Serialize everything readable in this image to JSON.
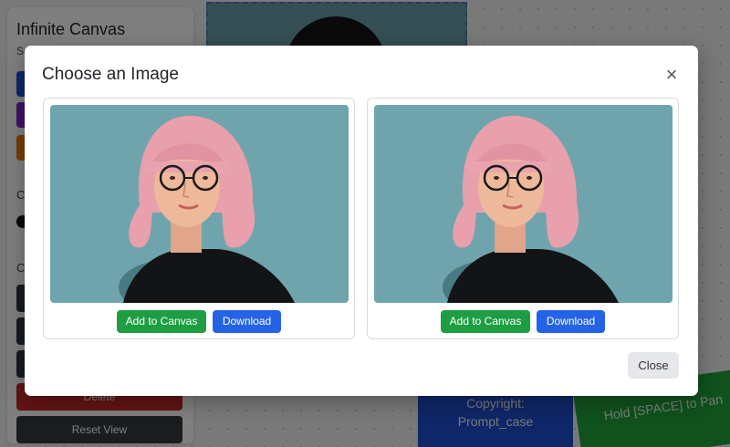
{
  "background": {
    "sidebar": {
      "title": "Infinite Canvas",
      "subtitle": "Se",
      "delete_label": "Delete",
      "reset_label": "Reset View",
      "swatch_colors": [
        "#1d4ed8",
        "#7e22ce",
        "#ea7a0c"
      ]
    },
    "copyright_text": "Copyright:\nPrompt_case",
    "pan_hint": "Hold [SPACE] to Pan"
  },
  "modal": {
    "title": "Choose an Image",
    "close_icon": "close-icon",
    "images": [
      {
        "add_label": "Add to Canvas",
        "download_label": "Download"
      },
      {
        "add_label": "Add to Canvas",
        "download_label": "Download"
      }
    ],
    "close_label": "Close"
  },
  "colors": {
    "add_button": "#1e9e43",
    "download_button": "#2563e6",
    "image_background": "#6fa4ad"
  }
}
